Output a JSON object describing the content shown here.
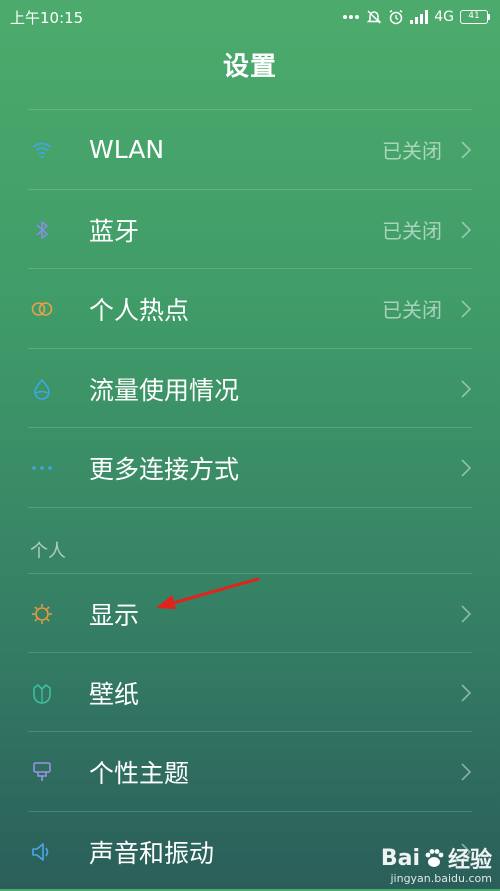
{
  "status_bar": {
    "time": "上午10:15",
    "network": "4G",
    "battery": "41"
  },
  "header": {
    "title": "设置"
  },
  "items": [
    {
      "label": "WLAN",
      "value": "已关闭",
      "icon": "wifi-icon",
      "icon_color": "#3ea7e0"
    },
    {
      "label": "蓝牙",
      "value": "已关闭",
      "icon": "bluetooth-icon",
      "icon_color": "#8a8fe6"
    },
    {
      "label": "个人热点",
      "value": "已关闭",
      "icon": "hotspot-icon",
      "icon_color": "#e8a04a"
    },
    {
      "label": "流量使用情况",
      "value": "",
      "icon": "data-usage-icon",
      "icon_color": "#3ea7e0"
    },
    {
      "label": "更多连接方式",
      "value": "",
      "icon": "more-connections-icon",
      "icon_color": "#3ea7e0"
    },
    {
      "label": "显示",
      "value": "",
      "icon": "brightness-icon",
      "icon_color": "#e89a3e"
    },
    {
      "label": "壁纸",
      "value": "",
      "icon": "wallpaper-icon",
      "icon_color": "#3fbfa0"
    },
    {
      "label": "个性主题",
      "value": "",
      "icon": "theme-icon",
      "icon_color": "#9a93e6"
    },
    {
      "label": "声音和振动",
      "value": "",
      "icon": "sound-icon",
      "icon_color": "#4aa8e6"
    }
  ],
  "sections": {
    "personal": "个人"
  },
  "watermark": {
    "brand": "Bai",
    "brand_tail": "经验",
    "url": "jingyan.baidu.com"
  }
}
